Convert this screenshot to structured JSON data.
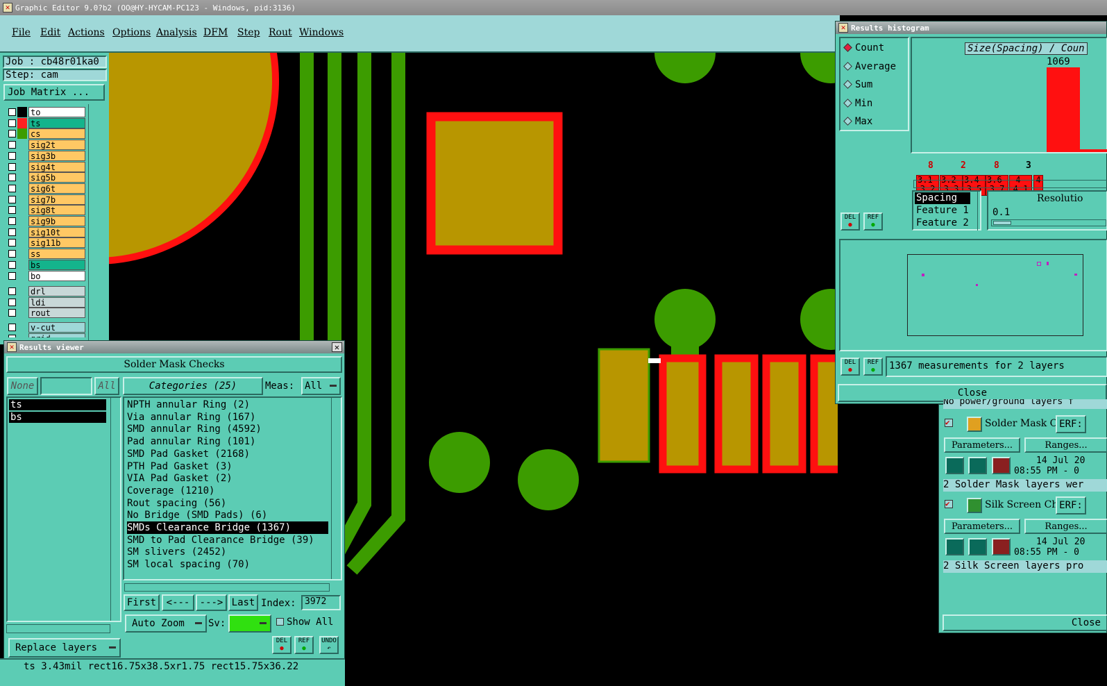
{
  "window": {
    "title": "Graphic Editor 9.0?b2 (OO@HY-HYCAM-PC123 - Windows, pid:3136)"
  },
  "menu": [
    "File",
    "Edit",
    "Actions",
    "Options",
    "Analysis",
    "DFM",
    "Step",
    "Rout",
    "Windows"
  ],
  "job": {
    "job_label": "Job : cb48r01ka0",
    "step_label": "Step: cam",
    "matrix_button": "Job Matrix ..."
  },
  "layers": [
    {
      "name": "to",
      "color": "#ffffff",
      "swatch": "#000000"
    },
    {
      "name": "ts",
      "color": "#14b48c",
      "swatch": "#ff2020"
    },
    {
      "name": "cs",
      "color": "#ffc864",
      "swatch": "#3c9c00"
    },
    {
      "name": "sig2t",
      "color": "#ffc864",
      "swatch": "#5cccb4"
    },
    {
      "name": "sig3b",
      "color": "#ffc864",
      "swatch": "#5cccb4"
    },
    {
      "name": "sig4t",
      "color": "#ffc864",
      "swatch": "#5cccb4"
    },
    {
      "name": "sig5b",
      "color": "#ffc864",
      "swatch": "#5cccb4"
    },
    {
      "name": "sig6t",
      "color": "#ffc864",
      "swatch": "#5cccb4"
    },
    {
      "name": "sig7b",
      "color": "#ffc864",
      "swatch": "#5cccb4"
    },
    {
      "name": "sig8t",
      "color": "#ffc864",
      "swatch": "#5cccb4"
    },
    {
      "name": "sig9b",
      "color": "#ffc864",
      "swatch": "#5cccb4"
    },
    {
      "name": "sig10t",
      "color": "#ffc864",
      "swatch": "#5cccb4"
    },
    {
      "name": "sig11b",
      "color": "#ffc864",
      "swatch": "#5cccb4"
    },
    {
      "name": "ss",
      "color": "#ffc864",
      "swatch": "#5cccb4"
    },
    {
      "name": "bs",
      "color": "#14b48c",
      "swatch": "#5cccb4"
    },
    {
      "name": "bo",
      "color": "#ffffff",
      "swatch": "#5cccb4"
    }
  ],
  "layers2": [
    {
      "name": "drl"
    },
    {
      "name": "ldi"
    },
    {
      "name": "rout"
    }
  ],
  "layers3": [
    {
      "name": "v-cut"
    },
    {
      "name": "grid"
    }
  ],
  "results_viewer": {
    "title": "Results viewer",
    "header": "Solder Mask Checks",
    "none_btn": "None",
    "all_btn": "All",
    "categories_label": "Categories (25)",
    "meas_label": "Meas:",
    "meas_value": "All",
    "layer_list": [
      "ts",
      "bs"
    ],
    "categories": [
      "NPTH annular Ring (2)",
      "Via annular Ring (167)",
      "SMD annular Ring (4592)",
      "Pad annular Ring (101)",
      "SMD Pad Gasket (2168)",
      "PTH Pad Gasket (3)",
      "VIA Pad Gasket (2)",
      "Coverage (1210)",
      "Rout spacing (56)",
      "No Bridge (SMD Pads) (6)",
      "SMDs Clearance Bridge (1367)",
      "SMD to Pad Clearance Bridge (39)",
      "SM slivers (2452)",
      "SM local spacing (70)"
    ],
    "selected_index": 10,
    "nav": {
      "first": "First",
      "prev": "<---",
      "next": "--->",
      "last": "Last",
      "index_label": "Index:",
      "index_value": "3972"
    },
    "auto_zoom": "Auto Zoom",
    "sv_label": "Sv:",
    "show_all": "Show All",
    "replace_layers": "Replace layers",
    "del": "DEL",
    "ref": "REF",
    "undo": "UNDO"
  },
  "status": {
    "text": "ts 3.43mil  rect16.75x38.5xr1.75  rect15.75x36.22"
  },
  "histogram": {
    "title": "Results histogram",
    "modes": [
      "Count",
      "Average",
      "Sum",
      "Min",
      "Max"
    ],
    "selected_mode": "Count",
    "chart_title": "Size(Spacing) / Coun",
    "peak_label": "1069",
    "bins": [
      {
        "label": "3.1-3.2",
        "count": "8"
      },
      {
        "label": "3.2-3.3",
        "count": "2"
      },
      {
        "label": "3.4-3.5",
        "count": "8"
      },
      {
        "label": "3.6-3.7",
        "count": "3"
      },
      {
        "label": "4-4.1",
        "count": "1069"
      },
      {
        "label": "4",
        "count": ""
      }
    ],
    "fields": [
      "Spacing",
      "Feature 1",
      "Feature 2"
    ],
    "resolution_label": "Resolutio",
    "resolution_value": "0.1",
    "measurements": "1367 measurements for 2 layers",
    "close": "Close",
    "del": "DEL",
    "ref": "REF"
  },
  "right_panel": {
    "top_text": "No power/ground layers f",
    "check1": {
      "name": "Solder Mask Che",
      "erf": "ERF:",
      "params": "Parameters...",
      "ranges": "Ranges...",
      "date": "14 Jul 20",
      "time": "08:55 PM - 0",
      "summary": "2 Solder Mask layers wer"
    },
    "check2": {
      "name": "Silk Screen Che",
      "erf": "ERF:",
      "params": "Parameters...",
      "ranges": "Ranges...",
      "date": "14 Jul 20",
      "time": "08:55 PM - 0",
      "summary": "2 Silk Screen layers pro"
    },
    "close": "Close"
  },
  "colors": {
    "mask_red": "#ff1010",
    "copper": "#b89600",
    "pad_green": "#3c9c00",
    "ui_teal": "#5cccb4"
  }
}
